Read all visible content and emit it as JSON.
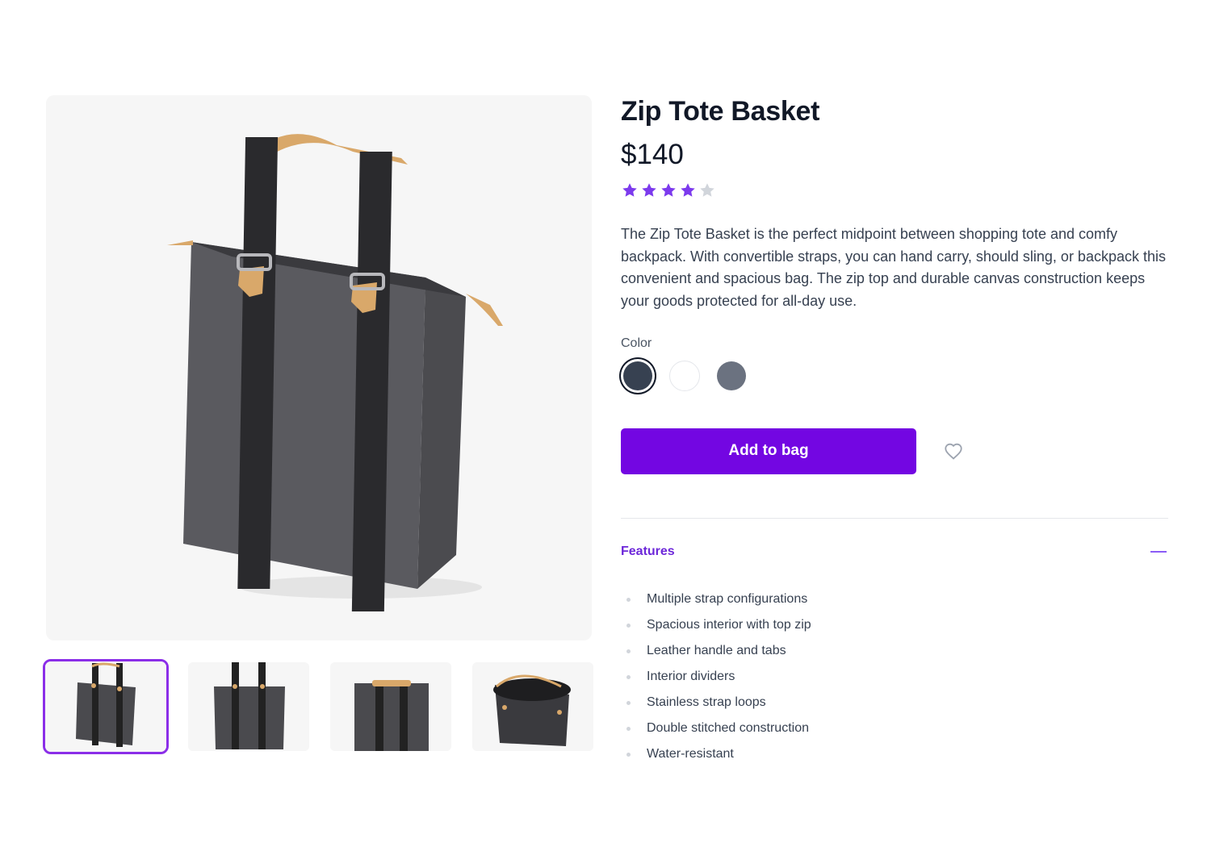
{
  "product": {
    "title": "Zip Tote Basket",
    "price": "$140",
    "rating": 4,
    "rating_max": 5,
    "description": "The Zip Tote Basket is the perfect midpoint between shopping tote and comfy backpack. With convertible straps, you can hand carry, should sling, or backpack this convenient and spacious bag. The zip top and durable canvas construction keeps your goods protected for all-day use."
  },
  "colors": {
    "label": "Color",
    "options": [
      {
        "name": "Washed Black",
        "hex": "#374151",
        "selected": true
      },
      {
        "name": "White",
        "hex": "#ffffff",
        "selected": false
      },
      {
        "name": "Washed Gray",
        "hex": "#6b7280",
        "selected": false
      }
    ]
  },
  "actions": {
    "add_to_bag": "Add to bag",
    "favorite_icon": "heart-icon"
  },
  "features": {
    "title": "Features",
    "items": [
      "Multiple strap configurations",
      "Spacious interior with top zip",
      "Leather handle and tabs",
      "Interior dividers",
      "Stainless strap loops",
      "Double stitched construction",
      "Water-resistant"
    ]
  },
  "theme": {
    "accent": "#7306e2",
    "star_filled": "#7c3aed",
    "star_empty": "#d1d5db",
    "thumbnail_selected_border": "#8b2ee8"
  },
  "gallery": {
    "selected_index": 0,
    "thumbnail_count": 4
  }
}
